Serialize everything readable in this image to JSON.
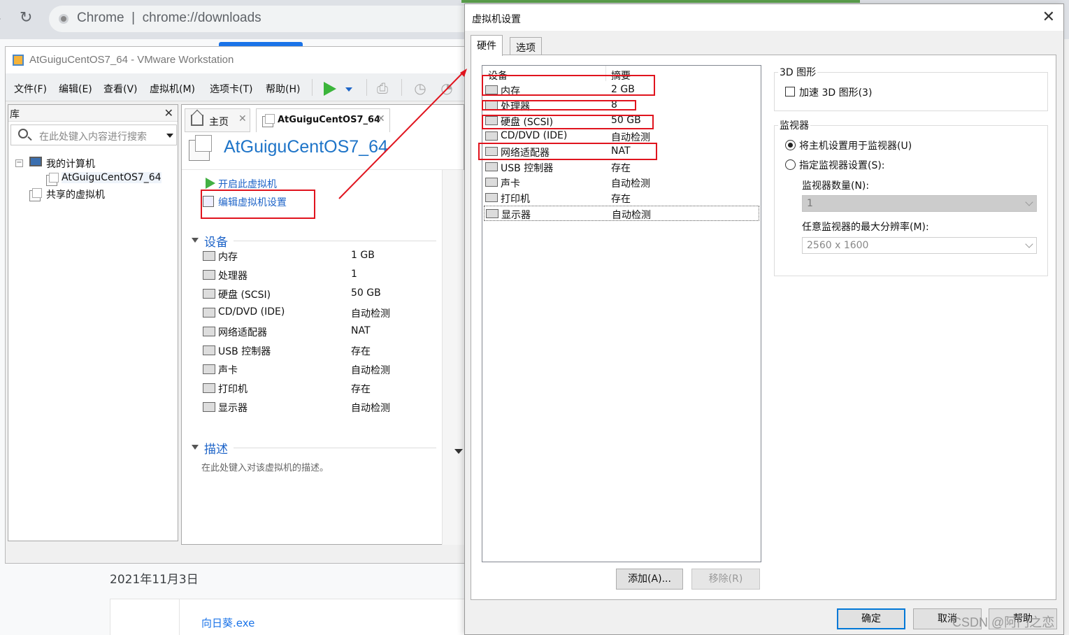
{
  "chrome": {
    "brand": "Chrome",
    "url": "chrome://downloads",
    "download_date": "2021年11月3日",
    "download_file": "向日葵.exe"
  },
  "vmware": {
    "title": "AtGuiguCentOS7_64 - VMware Workstation",
    "menu": [
      "文件(F)",
      "编辑(E)",
      "查看(V)",
      "虚拟机(M)",
      "选项卡(T)",
      "帮助(H)"
    ],
    "library": {
      "title": "库",
      "search_placeholder": "在此处键入内容进行搜索",
      "my_computer": "我的计算机",
      "vm_name": "AtGuiguCentOS7_64",
      "shared": "共享的虚拟机"
    },
    "tabs": {
      "home": "主页",
      "vm": "AtGuiguCentOS7_64"
    },
    "vm_title": "AtGuiguCentOS7_64",
    "actions": {
      "power_on": "开启此虚拟机",
      "edit_settings": "编辑虚拟机设置"
    },
    "devices_section": "设备",
    "devices": [
      {
        "name": "内存",
        "value": "1 GB",
        "icon": "memory-icon"
      },
      {
        "name": "处理器",
        "value": "1",
        "icon": "cpu-icon"
      },
      {
        "name": "硬盘 (SCSI)",
        "value": "50 GB",
        "icon": "hard-disk-icon"
      },
      {
        "name": "CD/DVD (IDE)",
        "value": "自动检测",
        "icon": "cd-dvd-icon"
      },
      {
        "name": "网络适配器",
        "value": "NAT",
        "icon": "network-adapter-icon"
      },
      {
        "name": "USB 控制器",
        "value": "存在",
        "icon": "usb-icon"
      },
      {
        "name": "声卡",
        "value": "自动检测",
        "icon": "sound-card-icon"
      },
      {
        "name": "打印机",
        "value": "存在",
        "icon": "printer-icon"
      },
      {
        "name": "显示器",
        "value": "自动检测",
        "icon": "display-icon"
      }
    ],
    "description_section": "描述",
    "description_placeholder": "在此处键入对该虚拟机的描述。"
  },
  "dialog": {
    "title": "虚拟机设置",
    "close": "✕",
    "tabs": {
      "hardware": "硬件",
      "options": "选项"
    },
    "list_headers": {
      "device": "设备",
      "summary": "摘要"
    },
    "devices": [
      {
        "name": "内存",
        "value": "2 GB"
      },
      {
        "name": "处理器",
        "value": "8"
      },
      {
        "name": "硬盘 (SCSI)",
        "value": "50 GB"
      },
      {
        "name": "CD/DVD (IDE)",
        "value": "自动检测"
      },
      {
        "name": "网络适配器",
        "value": "NAT"
      },
      {
        "name": "USB 控制器",
        "value": "存在"
      },
      {
        "name": "声卡",
        "value": "自动检测"
      },
      {
        "name": "打印机",
        "value": "存在"
      },
      {
        "name": "显示器",
        "value": "自动检测"
      }
    ],
    "selected_device": "显示器",
    "add_button": "添加(A)...",
    "remove_button": "移除(R)",
    "group_3d": "3D 图形",
    "accelerate_3d": "加速 3D 图形(3)",
    "group_monitor": "监视器",
    "use_host_setting": "将主机设置用于监视器(U)",
    "specify_setting": "指定监视器设置(S):",
    "monitor_count_label": "监视器数量(N):",
    "monitor_count": "1",
    "max_resolution_label": "任意监视器的最大分辨率(M):",
    "max_resolution": "2560 x 1600",
    "ok_button": "确定",
    "cancel_button": "取消",
    "help_button": "帮助"
  },
  "watermark": "CSDN @阿门之恋",
  "annotation_color": "#e0141e"
}
